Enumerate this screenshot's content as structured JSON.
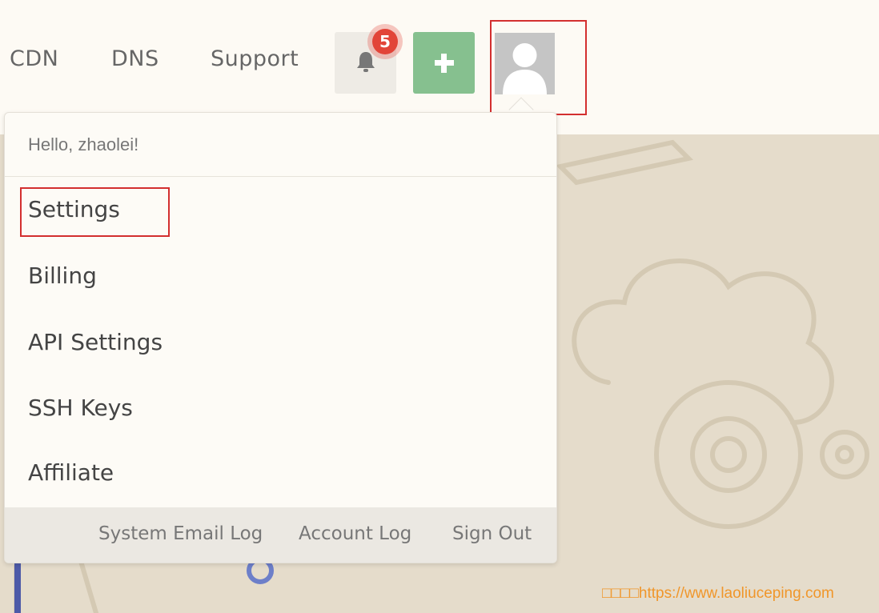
{
  "nav": {
    "links": [
      "CDN",
      "DNS",
      "Support"
    ],
    "notifications_count": "5"
  },
  "dropdown": {
    "greeting": "Hello, zhaolei!",
    "items": [
      "Settings",
      "Billing",
      "API Settings",
      "SSH Keys",
      "Affiliate"
    ],
    "footer_links": [
      "System Email Log",
      "Account Log",
      "Sign Out"
    ]
  },
  "watermark": "□□□□https://www.laoliuceping.com",
  "colors": {
    "accent_green": "#86c08f",
    "badge_red": "#e24438",
    "highlight_box": "#d32f2f",
    "watermark": "#f0962a"
  },
  "icons": [
    "bell-icon",
    "plus-icon",
    "user-avatar-icon"
  ]
}
